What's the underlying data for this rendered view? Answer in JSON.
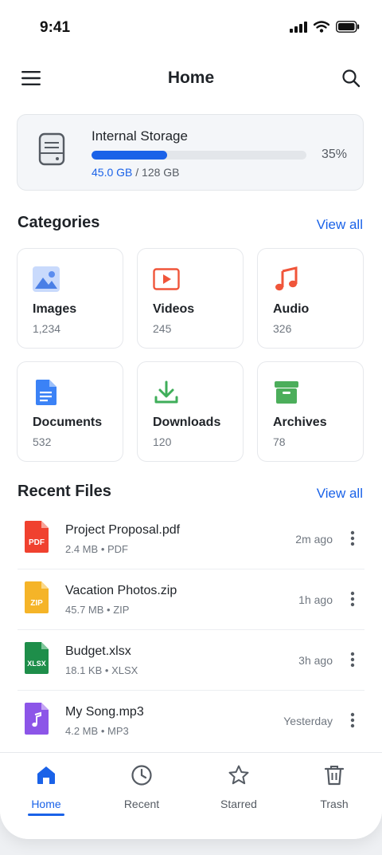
{
  "status": {
    "time": "9:41"
  },
  "appbar": {
    "title": "Home"
  },
  "storage": {
    "label": "Internal Storage",
    "used": "45.0 GB",
    "separator": "/",
    "total": "128 GB",
    "percent_text": "35%",
    "percent_value": 35
  },
  "categories": {
    "title": "Categories",
    "view_all": "View all",
    "items": [
      {
        "name": "Images",
        "count": "1,234",
        "icon": "image-icon",
        "color": "#5b8def"
      },
      {
        "name": "Videos",
        "count": "245",
        "icon": "video-icon",
        "color": "#f0553a"
      },
      {
        "name": "Audio",
        "count": "326",
        "icon": "music-note-icon",
        "color": "#f0553a"
      },
      {
        "name": "Documents",
        "count": "532",
        "icon": "document-icon",
        "color": "#3b82f6"
      },
      {
        "name": "Downloads",
        "count": "120",
        "icon": "download-icon",
        "color": "#3fae5a"
      },
      {
        "name": "Archives",
        "count": "78",
        "icon": "archive-icon",
        "color": "#4cae5b"
      }
    ]
  },
  "recent": {
    "title": "Recent Files",
    "view_all": "View all",
    "files": [
      {
        "name": "Project Proposal.pdf",
        "size": "2.4 MB",
        "type": "PDF",
        "ago": "2m ago",
        "badge": "PDF",
        "color": "#f0412f"
      },
      {
        "name": "Vacation Photos.zip",
        "size": "45.7 MB",
        "type": "ZIP",
        "ago": "1h ago",
        "badge": "ZIP",
        "color": "#f5b428"
      },
      {
        "name": "Budget.xlsx",
        "size": "18.1 KB",
        "type": "XLSX",
        "ago": "3h ago",
        "badge": "XLSX",
        "color": "#1e8e4a"
      },
      {
        "name": "My Song.mp3",
        "size": "4.2 MB",
        "type": "MP3",
        "ago": "Yesterday",
        "badge": "",
        "color": "#8c55e8"
      }
    ],
    "meta_sep": "•"
  },
  "nav": {
    "items": [
      {
        "label": "Home",
        "icon": "home-icon"
      },
      {
        "label": "Recent",
        "icon": "clock-icon"
      },
      {
        "label": "Starred",
        "icon": "star-icon"
      },
      {
        "label": "Trash",
        "icon": "trash-icon"
      }
    ]
  },
  "colors": {
    "accent": "#1a62e8",
    "text": "#1f2328",
    "muted": "#707780"
  }
}
